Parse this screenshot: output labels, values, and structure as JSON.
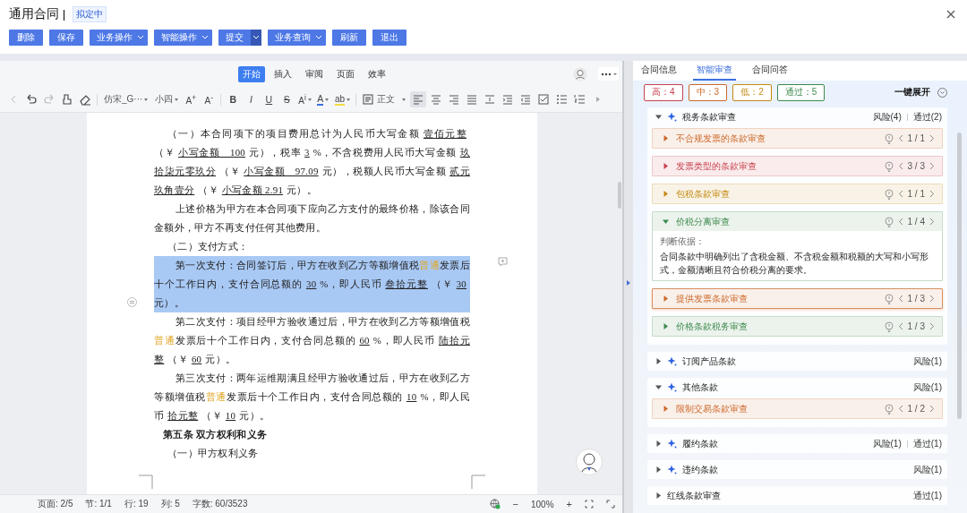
{
  "window": {
    "title": "通用合同 |",
    "status": "拟定中"
  },
  "buttons": [
    {
      "label": "删除",
      "kind": "plain"
    },
    {
      "label": "保存",
      "kind": "plain"
    },
    {
      "label": "业务操作",
      "kind": "dropdown"
    },
    {
      "label": "智能操作",
      "kind": "dropdown"
    },
    {
      "label": "提交",
      "kind": "split"
    },
    {
      "label": "业务查询",
      "kind": "dropdown"
    },
    {
      "label": "刷新",
      "kind": "plain"
    },
    {
      "label": "退出",
      "kind": "plain"
    }
  ],
  "ribbon_tabs": [
    {
      "label": "开始",
      "selected": true
    },
    {
      "label": "插入",
      "selected": false
    },
    {
      "label": "审阅",
      "selected": false
    },
    {
      "label": "页面",
      "selected": false
    },
    {
      "label": "效率",
      "selected": false
    }
  ],
  "toolbar": {
    "font": "仿宋_G···",
    "size": "小四",
    "style": "正文",
    "format_buttons": [
      {
        "label": "A$^{+}$",
        "kind": "grow"
      },
      {
        "label": "A$^{-}$",
        "kind": "shrink"
      },
      {
        "label": "B",
        "kind": "bold"
      },
      {
        "label": "I",
        "kind": "italic"
      },
      {
        "label": "U",
        "kind": "underline"
      },
      {
        "label": "S",
        "kind": "strike"
      },
      {
        "label": "A$^{i}$",
        "kind": "script"
      },
      {
        "label": "A",
        "kind": "font-color"
      },
      {
        "label": "ab",
        "kind": "highlight"
      }
    ],
    "align_buttons": [
      {
        "selected": true
      },
      {
        "selected": false
      },
      {
        "selected": false
      },
      {
        "selected": false
      }
    ]
  },
  "document": {
    "paragraphs": [
      {
        "kind": "item",
        "selected": false,
        "segments": [
          {
            "kind": "t",
            "text": "（一）本合同项下的项目费用总计为人民币大写金额"
          },
          {
            "kind": "u",
            "text": "壹佰元整"
          },
          {
            "kind": "t",
            "text": "（￥"
          },
          {
            "kind": "u",
            "text": "小写金额　100"
          },
          {
            "kind": "t",
            "text": "元），税率"
          },
          {
            "kind": "u",
            "text": "3"
          },
          {
            "kind": "t",
            "text": "%，不含税费用人民币大写金额"
          },
          {
            "kind": "u",
            "text": "玖拾柒元零玖分"
          },
          {
            "kind": "t",
            "text": "（￥"
          },
          {
            "kind": "u",
            "text": "小写金额　97.09"
          },
          {
            "kind": "t",
            "text": "元），税额人民币大写金额"
          },
          {
            "kind": "u",
            "text": "贰元玖角壹分"
          },
          {
            "kind": "t",
            "text": "（￥"
          },
          {
            "kind": "u",
            "text": "小写金额 2.91"
          },
          {
            "kind": "t",
            "text": "元）。"
          }
        ]
      },
      {
        "kind": "body",
        "selected": false,
        "segments": [
          {
            "kind": "t",
            "text": "上述价格为甲方在本合同项下应向乙方支付的最终价格，除该合同金额外，甲方不再支付任何其他费用。"
          }
        ]
      },
      {
        "kind": "item",
        "selected": false,
        "segments": [
          {
            "kind": "t",
            "text": "（二）支付方式："
          }
        ]
      },
      {
        "kind": "body",
        "selected": true,
        "segments": [
          {
            "kind": "t",
            "text": "第一次支付：合同签订后，甲方在收到乙方等额增值税"
          },
          {
            "kind": "m",
            "text": "普通"
          },
          {
            "kind": "t",
            "text": "发票后十个工作日内，支付合同总额的"
          },
          {
            "kind": "u",
            "text": "30"
          },
          {
            "kind": "t",
            "text": "%，即人民币"
          },
          {
            "kind": "u",
            "text": "叁拾元整"
          },
          {
            "kind": "t",
            "text": "（￥"
          },
          {
            "kind": "u",
            "text": "30"
          },
          {
            "kind": "t",
            "text": "元）。"
          }
        ]
      },
      {
        "kind": "body",
        "selected": false,
        "segments": [
          {
            "kind": "t",
            "text": "第二次支付：项目经甲方验收通过后，甲方在收到乙方等额增值税"
          },
          {
            "kind": "m",
            "text": "普通"
          },
          {
            "kind": "t",
            "text": "发票后十个工作日内，支付合同总额的"
          },
          {
            "kind": "u",
            "text": "60"
          },
          {
            "kind": "t",
            "text": "%，即人民币"
          },
          {
            "kind": "u",
            "text": "陆拾元整"
          },
          {
            "kind": "t",
            "text": "（￥"
          },
          {
            "kind": "u",
            "text": "60"
          },
          {
            "kind": "t",
            "text": "元）。"
          }
        ]
      },
      {
        "kind": "body",
        "selected": false,
        "segments": [
          {
            "kind": "t",
            "text": "第三次支付：两年运维期满且经甲方验收通过后，甲方在收到乙方等额增值税"
          },
          {
            "kind": "m",
            "text": "普通"
          },
          {
            "kind": "t",
            "text": "发票后十个工作日内，支付合同总额的"
          },
          {
            "kind": "u",
            "text": "10"
          },
          {
            "kind": "t",
            "text": "%，即人民币"
          },
          {
            "kind": "u",
            "text": "拾元整"
          },
          {
            "kind": "t",
            "text": "（￥"
          },
          {
            "kind": "u",
            "text": "10"
          },
          {
            "kind": "t",
            "text": "元）。"
          }
        ]
      },
      {
        "kind": "heading",
        "selected": false,
        "segments": [
          {
            "kind": "t",
            "text": "第五条  双方权利和义务"
          }
        ]
      },
      {
        "kind": "item",
        "selected": false,
        "segments": [
          {
            "kind": "t",
            "text": "（一）甲方权利义务"
          }
        ]
      }
    ]
  },
  "status_bar": {
    "left": [
      "页面: 2/5",
      "节: 1/1",
      "行: 19",
      "列: 5",
      "字数: 60/3523"
    ],
    "zoom": "100%",
    "zoom_out": "−",
    "zoom_in": "+"
  },
  "panel": {
    "tabs": [
      {
        "label": "合同信息",
        "selected": false
      },
      {
        "label": "智能审查",
        "selected": true
      },
      {
        "label": "合同问答",
        "selected": false
      }
    ],
    "badges": [
      {
        "label": "高：4",
        "color": "#c8434f"
      },
      {
        "label": "中：3",
        "color": "#cc6a2c"
      },
      {
        "label": "低：2",
        "color": "#c48a12"
      },
      {
        "label": "通过：5",
        "color": "#3c8a4c"
      }
    ],
    "expand_all": "一键展开",
    "groups": [
      {
        "title": "税务条款审查",
        "kind": "ai",
        "expanded": true,
        "stats": [
          "风险(4)",
          "通过(2)"
        ],
        "items": [
          {
            "title": "不合规发票的条款审查",
            "color": "#cc6a2c",
            "count": "1 / 1",
            "expanded": false,
            "selected": false
          },
          {
            "title": "发票类型的条款审查",
            "color": "#c8434f",
            "count": "3 / 3",
            "expanded": false,
            "selected": false
          },
          {
            "title": "包税条款审查",
            "color": "#c48a12",
            "count": "1 / 1",
            "expanded": false,
            "selected": false
          },
          {
            "title": "价税分离审查",
            "color": "#3c8a4c",
            "count": "1 / 4",
            "expanded": true,
            "selected": false,
            "basis_label": "判断依据：",
            "basis": "合同条款中明确列出了含税金额、不含税金额和税额的大写和小写形式，金额清晰且符合价税分离的要求。"
          },
          {
            "title": "提供发票条款审查",
            "color": "#cc6a2c",
            "count": "1 / 3",
            "expanded": false,
            "selected": true
          },
          {
            "title": "价格条款税务审查",
            "color": "#3c8a4c",
            "count": "1 / 3",
            "expanded": false,
            "selected": false
          }
        ]
      },
      {
        "title": "订阅产品条款",
        "kind": "ai",
        "expanded": false,
        "stats": [
          "风险(1)"
        ]
      },
      {
        "title": "其他条款",
        "kind": "ai",
        "expanded": true,
        "stats": [
          "风险(1)"
        ],
        "items": [
          {
            "title": "限制交易条款审查",
            "color": "#cc6a2c",
            "count": "1 / 2",
            "expanded": false,
            "selected": false
          }
        ]
      },
      {
        "title": "履约条款",
        "kind": "ai",
        "expanded": false,
        "stats": [
          "风险(1)",
          "通过(1)"
        ]
      },
      {
        "title": "违约条款",
        "kind": "ai",
        "expanded": false,
        "stats": [
          "风险(1)"
        ]
      },
      {
        "title": "红线条款审查",
        "kind": "plain",
        "expanded": false,
        "stats": [
          "通过(1)"
        ]
      }
    ]
  }
}
